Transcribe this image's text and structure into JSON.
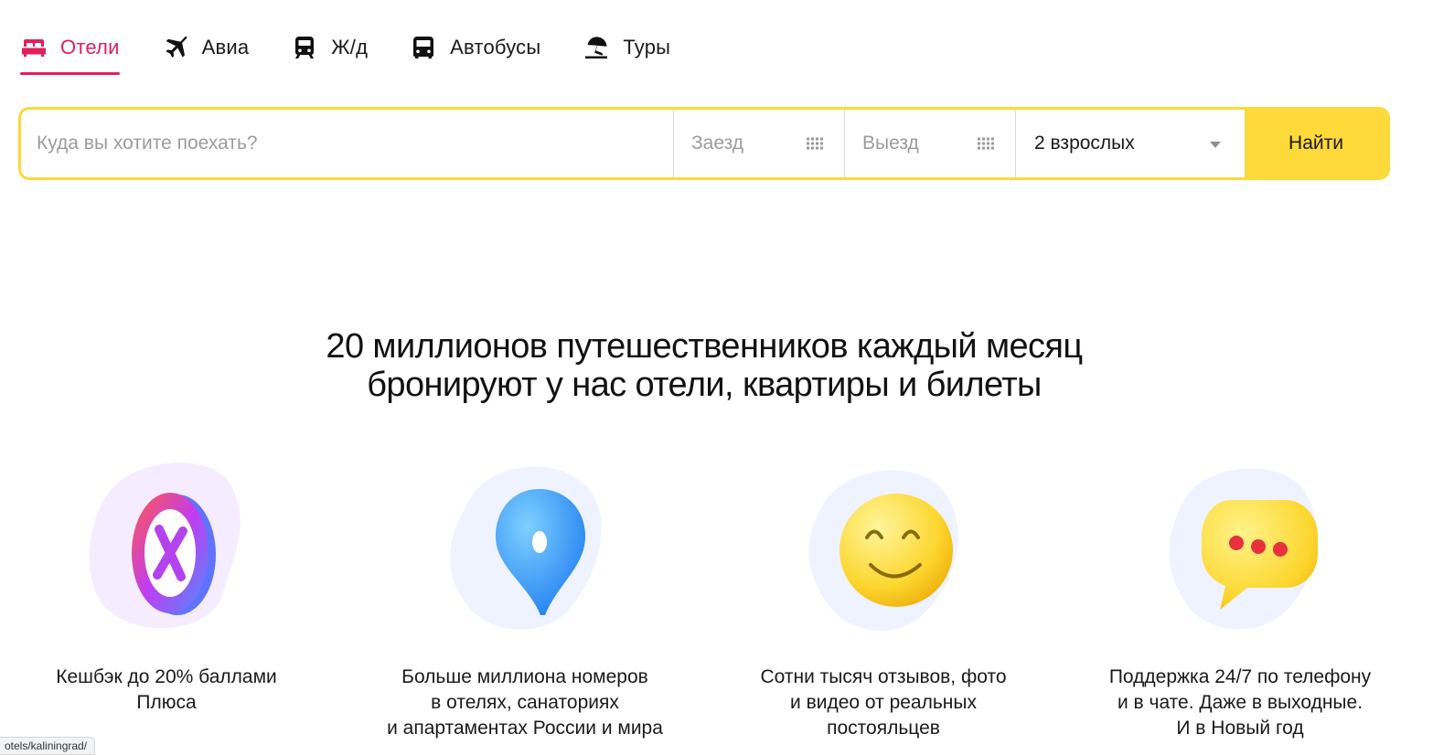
{
  "tabs": [
    {
      "label": "Отели",
      "icon": "bed-icon",
      "active": true
    },
    {
      "label": "Авиа",
      "icon": "airplane-icon",
      "active": false
    },
    {
      "label": "Ж/д",
      "icon": "train-icon",
      "active": false
    },
    {
      "label": "Автобусы",
      "icon": "bus-icon",
      "active": false
    },
    {
      "label": "Туры",
      "icon": "beach-umbrella-icon",
      "active": false
    }
  ],
  "search": {
    "destination_placeholder": "Куда вы хотите поехать?",
    "checkin_placeholder": "Заезд",
    "checkout_placeholder": "Выезд",
    "guests_value": "2 взрослых",
    "find_label": "Найти"
  },
  "headline": {
    "line1": "20 миллионов путешественников каждый месяц",
    "line2": "бронируют у нас отели, квартиры и билеты"
  },
  "features": [
    {
      "icon": "plus-cashback-icon",
      "lines": [
        "Кешбэк до 20% баллами",
        "Плюса"
      ]
    },
    {
      "icon": "map-pin-icon",
      "lines": [
        "Больше миллиона номеров",
        "в отелях, санаториях",
        "и апартаментах России и мира"
      ]
    },
    {
      "icon": "smiley-icon",
      "lines": [
        "Сотни тысяч отзывов, фото",
        "и видео от реальных",
        "постояльцев"
      ]
    },
    {
      "icon": "chat-bubble-icon",
      "lines": [
        "Поддержка 24/7 по телефону",
        "и в чате. Даже в выходные.",
        "И в Новый год"
      ]
    }
  ],
  "status_url": "otels/kaliningrad/",
  "colors": {
    "accent": "#e0205b",
    "yellow": "#fdd93a",
    "text": "#1a1a1a",
    "placeholder": "#9c9c9c"
  }
}
